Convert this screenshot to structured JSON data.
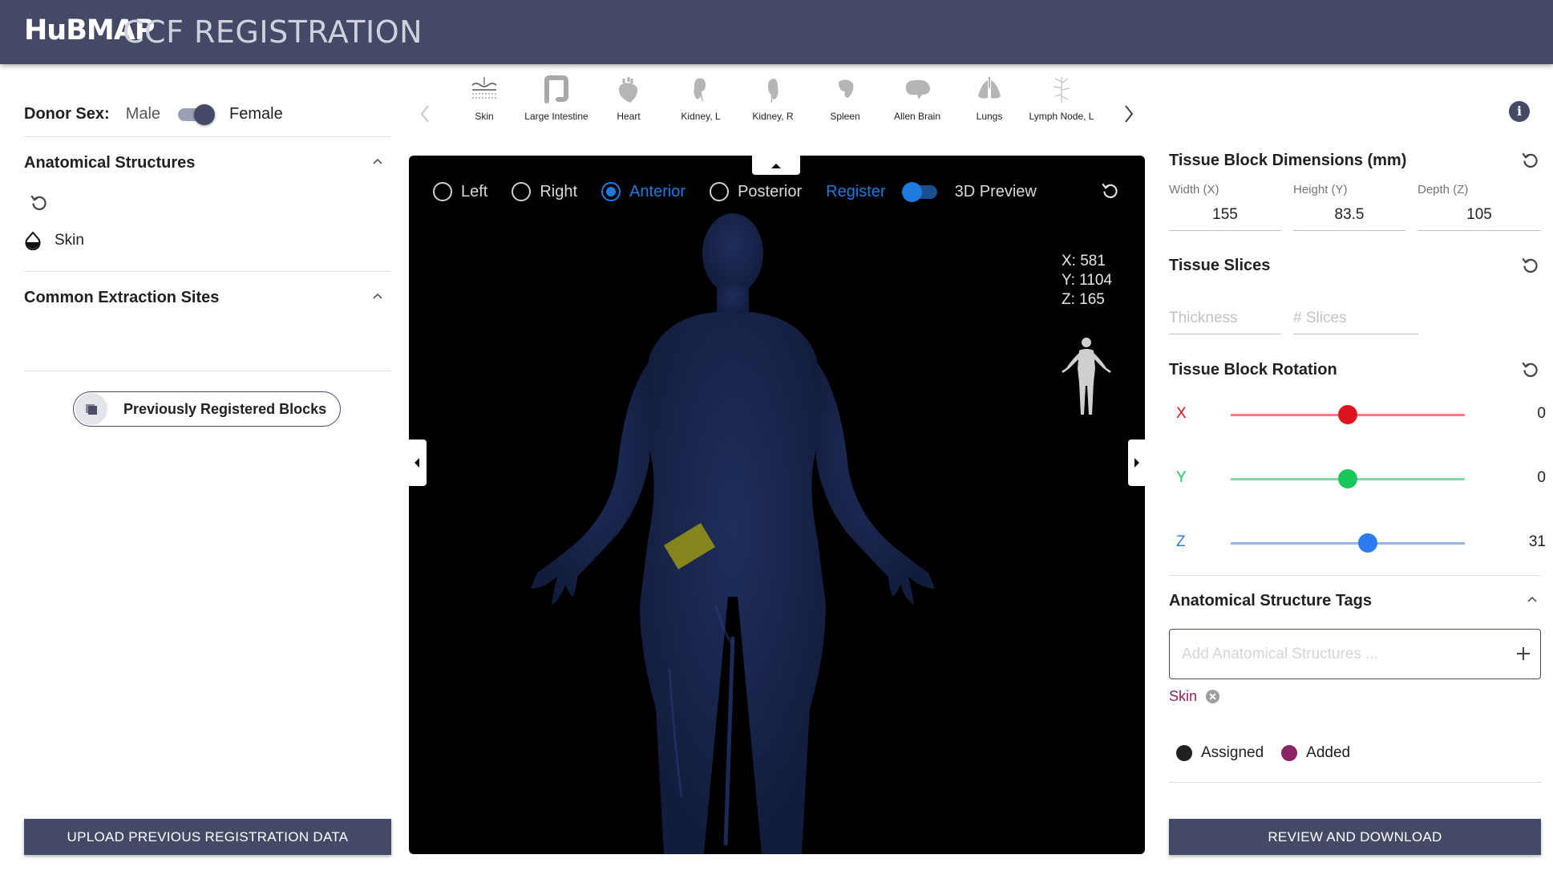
{
  "header": {
    "brand": "HuBMAP",
    "title": "CCF REGISTRATION",
    "bg_color": "#444a65"
  },
  "left": {
    "donor_label": "Donor Sex:",
    "sex_male": "Male",
    "sex_female": "Female",
    "donor_sex_selected": "Female",
    "anatomical_title": "Anatomical Structures",
    "anatomical_items": [
      {
        "label": "Skin",
        "icon": "skin-drop-icon"
      }
    ],
    "extraction_title": "Common Extraction Sites",
    "prev_blocks_button": "Previously Registered Blocks",
    "upload_button": "UPLOAD PREVIOUS REGISTRATION DATA"
  },
  "organs": [
    {
      "label": "Skin",
      "icon": "skin-icon"
    },
    {
      "label": "Large Intestine",
      "icon": "large-intestine-icon"
    },
    {
      "label": "Heart",
      "icon": "heart-icon"
    },
    {
      "label": "Kidney, L",
      "icon": "kidney-left-icon"
    },
    {
      "label": "Kidney, R",
      "icon": "kidney-right-icon"
    },
    {
      "label": "Spleen",
      "icon": "spleen-icon"
    },
    {
      "label": "Allen Brain",
      "icon": "brain-icon"
    },
    {
      "label": "Lungs",
      "icon": "lungs-icon"
    },
    {
      "label": "Lymph Node, L",
      "icon": "lymph-node-icon"
    }
  ],
  "viewer": {
    "views": [
      {
        "label": "Left",
        "selected": false
      },
      {
        "label": "Right",
        "selected": false
      },
      {
        "label": "Anterior",
        "selected": true
      },
      {
        "label": "Posterior",
        "selected": false
      }
    ],
    "register_label": "Register",
    "preview_label": "3D Preview",
    "coords": {
      "x": "X: 581",
      "y": "Y: 1104",
      "z": "Z: 165"
    },
    "accent_color": "#1f7ae0",
    "body_color": "#1a2750",
    "block_color": "#8a8a1a"
  },
  "right": {
    "dimensions_title": "Tissue Block Dimensions (mm)",
    "width_label": "Width (X)",
    "width_value": "155",
    "height_label": "Height (Y)",
    "height_value": "83.5",
    "depth_label": "Depth (Z)",
    "depth_value": "105",
    "slices_title": "Tissue Slices",
    "thickness_placeholder": "Thickness",
    "slices_placeholder": "# Slices",
    "rotation_title": "Tissue Block Rotation",
    "rotation": [
      {
        "axis": "X",
        "value": "0",
        "fraction": 0.5,
        "color": "#e0141e",
        "track": "#f08080"
      },
      {
        "axis": "Y",
        "value": "0",
        "fraction": 0.5,
        "color": "#18c75a",
        "track": "#7fdca0"
      },
      {
        "axis": "Z",
        "value": "31",
        "fraction": 0.586,
        "color": "#2a7cf0",
        "track": "#8db8f4"
      }
    ],
    "tags_title": "Anatomical Structure Tags",
    "tags_placeholder": "Add Anatomical Structures ...",
    "tags": [
      {
        "label": "Skin",
        "color": "#8b2367"
      }
    ],
    "legend_assigned": "Assigned",
    "legend_added": "Added",
    "assigned_color": "#212121",
    "added_color": "#8b2367",
    "review_button": "REVIEW AND DOWNLOAD"
  }
}
